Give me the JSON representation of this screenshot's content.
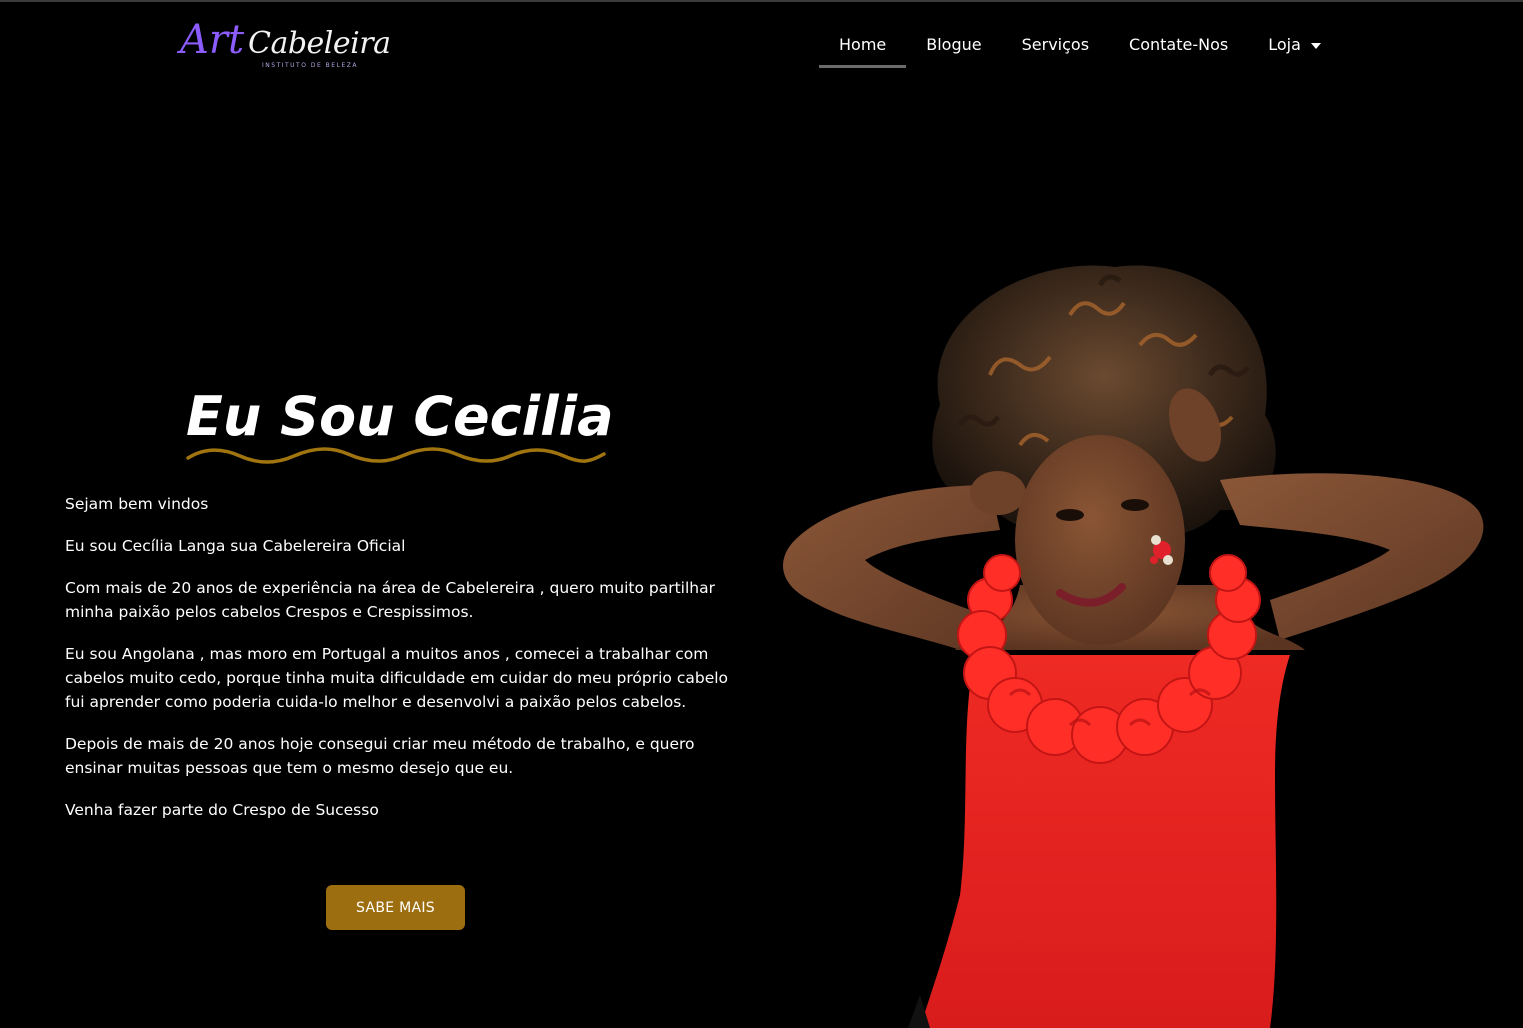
{
  "header": {
    "logo": {
      "art": "Art",
      "cabeleira": "Cabeleira",
      "subtitle": "INSTITUTO DE BELEZA"
    },
    "nav": [
      {
        "label": "Home",
        "active": true
      },
      {
        "label": "Blogue",
        "active": false
      },
      {
        "label": "Serviços",
        "active": false
      },
      {
        "label": "Contate-Nos",
        "active": false
      },
      {
        "label": "Loja",
        "active": false,
        "has_dropdown": true
      }
    ]
  },
  "hero": {
    "title": "Eu Sou Cecilia",
    "paragraphs": [
      "Sejam bem vindos",
      "Eu sou Cecília Langa sua Cabelereira Oficial",
      "Com mais de 20 anos de experiência na área de Cabelereira , quero muito partilhar minha paixão pelos cabelos Crespos e Crespissimos.",
      "Eu sou Angolana , mas moro em Portugal a muitos anos , comecei a trabalhar com cabelos muito cedo, porque tinha muita dificuldade em cuidar do meu próprio cabelo fui aprender como poderia cuida-lo melhor e desenvolvi a paixão pelos cabelos.",
      "Depois de mais de 20 anos hoje consegui criar meu método de trabalho, e quero ensinar muitas pessoas que tem o mesmo desejo que eu.",
      "Venha fazer parte do Crespo de Sucesso"
    ],
    "cta_label": "SABE MAIS"
  },
  "colors": {
    "background": "#000000",
    "accent_gold": "#9d6e0f",
    "logo_purple": "#8c5cff",
    "dress_red": "#e8201f"
  },
  "icons": {
    "dropdown": "caret-down-icon"
  }
}
